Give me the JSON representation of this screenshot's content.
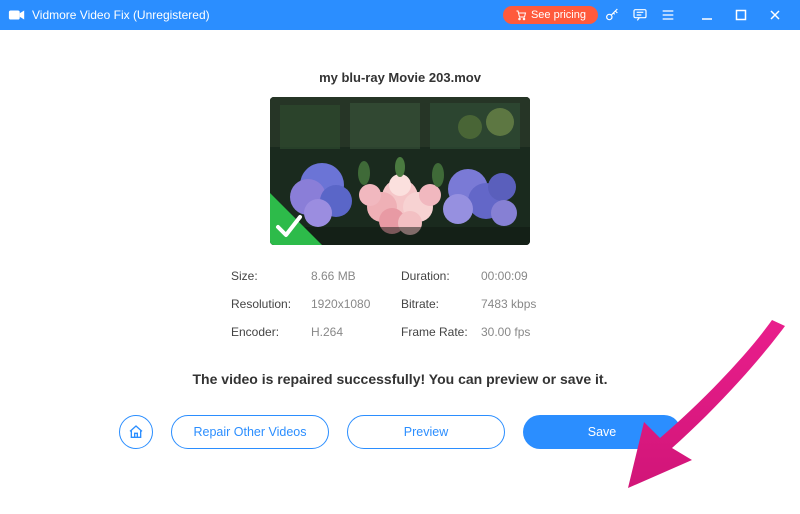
{
  "titlebar": {
    "app_name": "Vidmore Video Fix (Unregistered)",
    "see_pricing_label": "See pricing"
  },
  "file": {
    "name": "my blu-ray Movie 203.mov"
  },
  "meta": {
    "size_label": "Size:",
    "size_value": "8.66 MB",
    "duration_label": "Duration:",
    "duration_value": "00:00:09",
    "resolution_label": "Resolution:",
    "resolution_value": "1920x1080",
    "bitrate_label": "Bitrate:",
    "bitrate_value": "7483 kbps",
    "encoder_label": "Encoder:",
    "encoder_value": "H.264",
    "framerate_label": "Frame Rate:",
    "framerate_value": "30.00 fps"
  },
  "status": {
    "message": "The video is repaired successfully! You can preview or save it."
  },
  "buttons": {
    "repair_other": "Repair Other Videos",
    "preview": "Preview",
    "save": "Save"
  },
  "colors": {
    "primary": "#2b8eff",
    "accent_orange": "#ff5a3c",
    "arrow": "#e91e8c"
  }
}
